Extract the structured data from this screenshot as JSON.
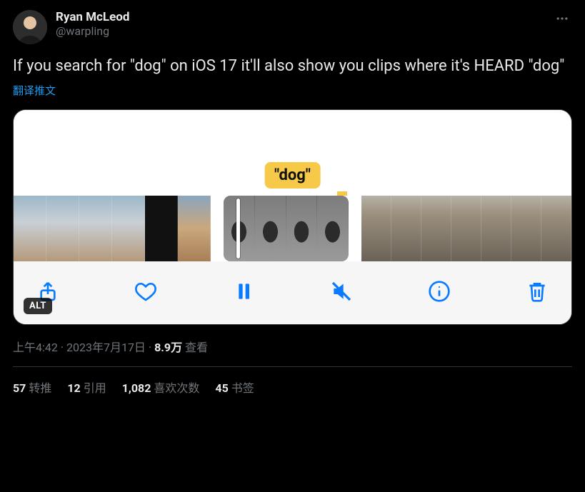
{
  "author": {
    "display_name": "Ryan McLeod",
    "handle": "@warpling"
  },
  "content": {
    "text": "If you search for \"dog\" on iOS 17 it'll also show you clips where it's HEARD \"dog\"",
    "translate_label": "翻译推文"
  },
  "media": {
    "caption_text": "\"dog\"",
    "alt_badge": "ALT",
    "toolbar_icons": {
      "share": "share-icon",
      "heart": "heart-icon",
      "pause": "pause-icon",
      "mute": "mute-icon",
      "info": "info-icon",
      "trash": "trash-icon"
    }
  },
  "meta": {
    "time": "上午4:42",
    "dot1": " · ",
    "date": "2023年7月17日",
    "dot2": " · ",
    "views_count": "8.9万",
    "views_label": " 查看"
  },
  "stats": {
    "retweets": {
      "count": "57",
      "label": "转推"
    },
    "quotes": {
      "count": "12",
      "label": "引用"
    },
    "likes": {
      "count": "1,082",
      "label": "喜欢次数"
    },
    "bookmarks": {
      "count": "45",
      "label": "书签"
    }
  }
}
